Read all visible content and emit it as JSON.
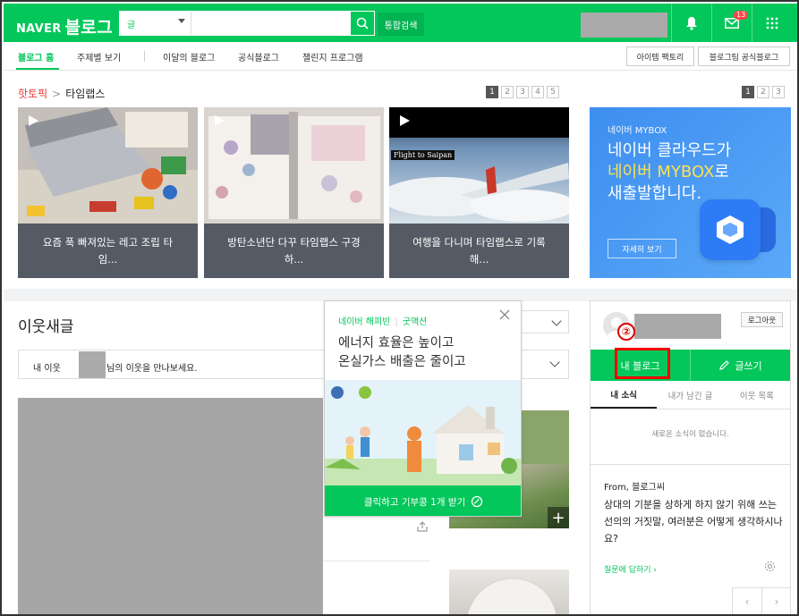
{
  "header": {
    "logo_naver": "NAVER",
    "logo_blog": "블로그",
    "search_select": "글",
    "search_placeholder": "",
    "integrated_search": "통합검색",
    "mail_badge": "13",
    "brand_color": "#03c75a"
  },
  "nav": {
    "items": [
      "블로그 홈",
      "주제별 보기",
      "이달의 블로그",
      "공식블로그",
      "챌린지 프로그램"
    ],
    "right_buttons": [
      "아이템 팩토리",
      "블로그팀 공식블로그"
    ]
  },
  "hot": {
    "crumb_main": "핫토픽",
    "crumb_sub": "타임랩스",
    "pager": [
      "1",
      "2",
      "3",
      "4",
      "5"
    ],
    "right_pager": [
      "1",
      "2",
      "3"
    ],
    "cards": [
      {
        "caption": "요즘 푹 빠져있는 레고 조립 타임..."
      },
      {
        "caption": "방탄소년단 다꾸 타임랩스 구경하..."
      },
      {
        "caption": "여행을 다니며 타임랩스로 기록해...",
        "photo_label": "Flight to Saipan"
      }
    ]
  },
  "mybox": {
    "label": "네이버 MYBOX",
    "line1": "네이버 클라우드가",
    "line2_y": "네이버 MYBOX",
    "line2_w": "로",
    "line3": "새출발합니다.",
    "details": "자세히 보기"
  },
  "feed": {
    "title": "이웃새글",
    "box_text_1": "내 이웃",
    "box_text_2": "님의 이웃을 만나보세요."
  },
  "ad": {
    "brand": "네이버 해피빈",
    "brand_sub": "굿액션",
    "headline_1": "에너지 효율은 높이고",
    "headline_2": "온실가스 배출은 줄이고",
    "cta": "클릭하고 기부콩 1개 받기"
  },
  "profile": {
    "logout": "로그아웃",
    "step_marker": "②",
    "my_blog": "내 블로그",
    "write": "글쓰기",
    "tabs": [
      "내 소식",
      "내가 남긴 글",
      "이웃 목록"
    ],
    "no_news": "새로운 소식이 없습니다.",
    "from": "From, 블로그씨",
    "question": "상대의 기분을 상하게 하지 않기 위해 쓰는 선의의 거짓말, 여러분은 어떻게 생각하시나요?",
    "answer_link": "질문에 답하기"
  }
}
